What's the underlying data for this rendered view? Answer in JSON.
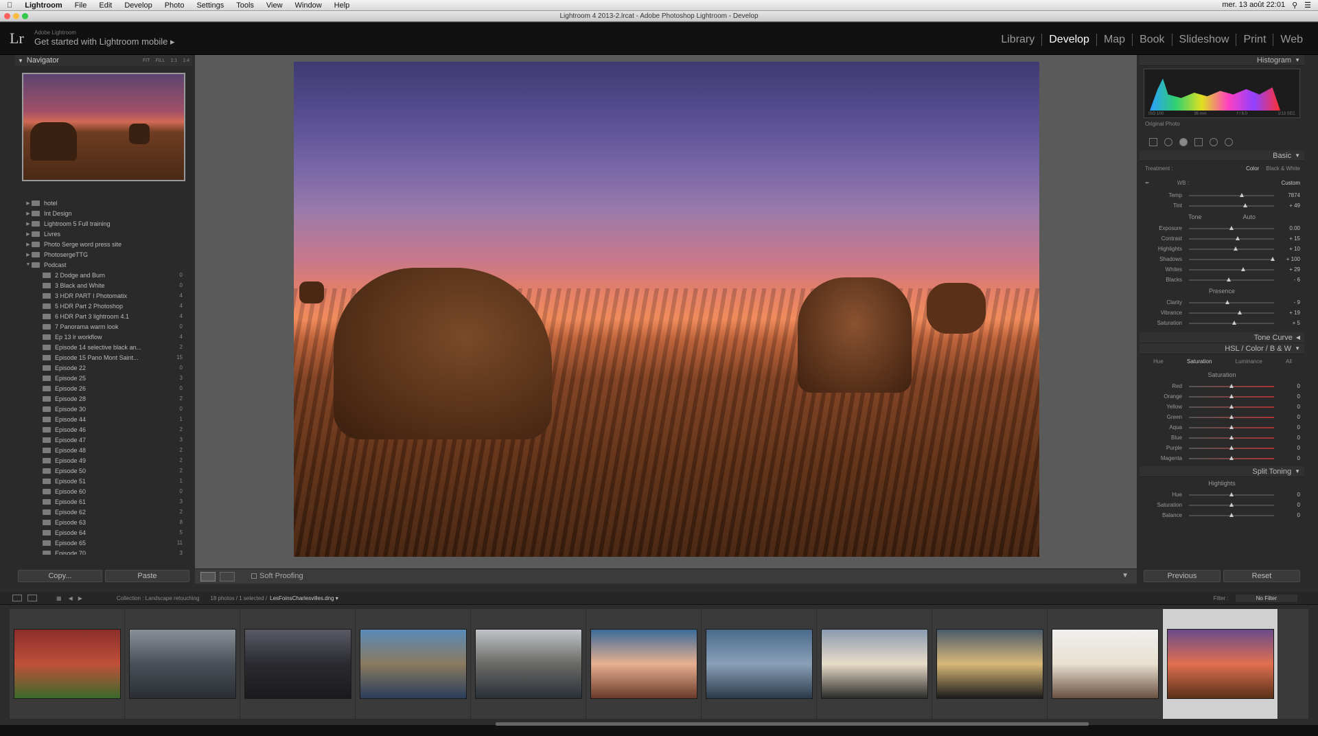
{
  "macos_menu": {
    "app": "Lightroom",
    "items": [
      "File",
      "Edit",
      "Develop",
      "Photo",
      "Settings",
      "Tools",
      "View",
      "Window",
      "Help"
    ],
    "clock": "mer. 13 août  22:01"
  },
  "window": {
    "title": "Lightroom 4 2013-2.lrcat - Adobe Photoshop Lightroom - Develop"
  },
  "identity_plate": {
    "logo": "Lr",
    "small": "Adobe Lightroom",
    "text": "Get started with Lightroom mobile  ▸"
  },
  "modules": [
    {
      "label": "Library"
    },
    {
      "label": "Develop"
    },
    {
      "label": "Map"
    },
    {
      "label": "Book"
    },
    {
      "label": "Slideshow"
    },
    {
      "label": "Print"
    },
    {
      "label": "Web"
    }
  ],
  "active_module": "Develop",
  "navigator": {
    "title": "Navigator",
    "zoom": [
      "FIT",
      "FILL",
      "1:1",
      "1:4"
    ]
  },
  "collections": [
    {
      "name": "hotel",
      "level": 1,
      "count": ""
    },
    {
      "name": "Int Design",
      "level": 1,
      "count": ""
    },
    {
      "name": "Lightroom 5 Full training",
      "level": 1,
      "count": ""
    },
    {
      "name": "Livres",
      "level": 1,
      "count": ""
    },
    {
      "name": "Photo Serge word press site",
      "level": 1,
      "count": ""
    },
    {
      "name": "PhotosergeTTG",
      "level": 1,
      "count": ""
    },
    {
      "name": "Podcast",
      "level": 1,
      "count": ""
    },
    {
      "name": "2 Dodge and Burn",
      "level": 2,
      "count": "0"
    },
    {
      "name": "3 Black and White",
      "level": 2,
      "count": "0"
    },
    {
      "name": "3 HDR PART I Photomatix",
      "level": 2,
      "count": "4"
    },
    {
      "name": "5 HDR Part 2 Photoshop",
      "level": 2,
      "count": "4"
    },
    {
      "name": "6 HDR Part 3 lightroom 4.1",
      "level": 2,
      "count": "4"
    },
    {
      "name": "7 Panorama warm look",
      "level": 2,
      "count": "0"
    },
    {
      "name": "Ep 13 lr workflow",
      "level": 2,
      "count": "4"
    },
    {
      "name": "Episode 14 selective black an...",
      "level": 2,
      "count": "2"
    },
    {
      "name": "Episode 15 Pano Mont Saint...",
      "level": 2,
      "count": "15"
    },
    {
      "name": "Episode 22",
      "level": 2,
      "count": "0"
    },
    {
      "name": "Episode 25",
      "level": 2,
      "count": "3"
    },
    {
      "name": "Episode 26",
      "level": 2,
      "count": "0"
    },
    {
      "name": "Episode 28",
      "level": 2,
      "count": "2"
    },
    {
      "name": "Episode 30",
      "level": 2,
      "count": "0"
    },
    {
      "name": "Episode 44",
      "level": 2,
      "count": "1"
    },
    {
      "name": "Episode 46",
      "level": 2,
      "count": "2"
    },
    {
      "name": "Episode 47",
      "level": 2,
      "count": "3"
    },
    {
      "name": "Episode 48",
      "level": 2,
      "count": "2"
    },
    {
      "name": "Episode 49",
      "level": 2,
      "count": "2"
    },
    {
      "name": "Episode 50",
      "level": 2,
      "count": "2"
    },
    {
      "name": "Episode 51",
      "level": 2,
      "count": "1"
    },
    {
      "name": "Episode 60",
      "level": 2,
      "count": "0"
    },
    {
      "name": "Episode 61",
      "level": 2,
      "count": "3"
    },
    {
      "name": "Episode 62",
      "level": 2,
      "count": "2"
    },
    {
      "name": "Episode 63",
      "level": 2,
      "count": "8"
    },
    {
      "name": "Episode 64",
      "level": 2,
      "count": "5"
    },
    {
      "name": "Episode 65",
      "level": 2,
      "count": "11"
    },
    {
      "name": "Episode 70",
      "level": 2,
      "count": "3"
    },
    {
      "name": "Episode 74",
      "level": 2,
      "count": "2"
    }
  ],
  "left_buttons": {
    "copy": "Copy...",
    "paste": "Paste"
  },
  "toolbar": {
    "soft_proofing": "Soft Proofing"
  },
  "histogram": {
    "title": "Histogram",
    "info": [
      "ISO 100",
      "35 mm",
      "f / 8.0",
      "1/13 SEC"
    ],
    "original_photo": "Original Photo"
  },
  "basic": {
    "title": "Basic",
    "treatment_label": "Treatment :",
    "treatment_color": "Color",
    "treatment_bw": "Black & White",
    "wb_label": "WB :",
    "wb_value": "Custom",
    "tone_label": "Tone",
    "tone_auto": "Auto",
    "presence_label": "Presence",
    "wb_sliders": [
      {
        "label": "Temp",
        "value": "7874",
        "pos": 0.62
      },
      {
        "label": "Tint",
        "value": "+ 49",
        "pos": 0.66
      }
    ],
    "tone_sliders": [
      {
        "label": "Exposure",
        "value": "0.00",
        "pos": 0.5
      },
      {
        "label": "Contrast",
        "value": "+ 15",
        "pos": 0.57
      },
      {
        "label": "Highlights",
        "value": "+ 10",
        "pos": 0.55
      },
      {
        "label": "Shadows",
        "value": "+ 100",
        "pos": 0.98
      },
      {
        "label": "Whites",
        "value": "+ 29",
        "pos": 0.64
      },
      {
        "label": "Blacks",
        "value": "- 6",
        "pos": 0.47
      }
    ],
    "presence_sliders": [
      {
        "label": "Clarity",
        "value": "- 9",
        "pos": 0.45
      },
      {
        "label": "Vibrance",
        "value": "+ 19",
        "pos": 0.6
      },
      {
        "label": "Saturation",
        "value": "+ 5",
        "pos": 0.53
      }
    ]
  },
  "tone_curve": {
    "title": "Tone Curve"
  },
  "hsl": {
    "title": "HSL  /  Color  /  B & W",
    "tabs": [
      "Hue",
      "Saturation",
      "Luminance",
      "All"
    ],
    "section": "Saturation",
    "sliders": [
      {
        "label": "Red",
        "value": "0"
      },
      {
        "label": "Orange",
        "value": "0"
      },
      {
        "label": "Yellow",
        "value": "0"
      },
      {
        "label": "Green",
        "value": "0"
      },
      {
        "label": "Aqua",
        "value": "0"
      },
      {
        "label": "Blue",
        "value": "0"
      },
      {
        "label": "Purple",
        "value": "0"
      },
      {
        "label": "Magenta",
        "value": "0"
      }
    ]
  },
  "split_toning": {
    "title": "Split Toning",
    "section": "Highlights",
    "sliders": [
      {
        "label": "Hue",
        "value": "0"
      },
      {
        "label": "Saturation",
        "value": "0"
      },
      {
        "label": "Balance",
        "value": "0"
      }
    ]
  },
  "right_buttons": {
    "previous": "Previous",
    "reset": "Reset"
  },
  "filmstrip_bar": {
    "collection": "Collection : Landscape retouching",
    "count": "18 photos / 1 selected /",
    "filename": "LesFoinsCharlesvilles.dng ▾",
    "filter_label": "Filter :",
    "filter_value": "No Filter"
  },
  "thumbnails": [
    {
      "colors": [
        "#8a2e2a",
        "#c0503a",
        "#3a6a2a"
      ]
    },
    {
      "colors": [
        "#8a9098",
        "#4a5058",
        "#2a2e34"
      ]
    },
    {
      "colors": [
        "#5a5a66",
        "#2a2a30",
        "#1a1a1e"
      ]
    },
    {
      "colors": [
        "#5a8ab8",
        "#8a7a60",
        "#2a3e5a"
      ]
    },
    {
      "colors": [
        "#c0c4c8",
        "#6a6a66",
        "#2a3038"
      ]
    },
    {
      "colors": [
        "#3a6a98",
        "#e8b090",
        "#6a3a2a"
      ]
    },
    {
      "colors": [
        "#4a6a8a",
        "#8aa0b8",
        "#2a3a4a"
      ]
    },
    {
      "colors": [
        "#8a9ab0",
        "#e8dcc8",
        "#2a2a2a"
      ]
    },
    {
      "colors": [
        "#4a5a6a",
        "#d8b878",
        "#1a1a1a"
      ]
    },
    {
      "colors": [
        "#f0f0f0",
        "#e8e0d0",
        "#6a5040"
      ]
    },
    {
      "colors": [
        "#6a4a8a",
        "#e07050",
        "#5a3018"
      ]
    }
  ],
  "selected_thumbnail": 10
}
